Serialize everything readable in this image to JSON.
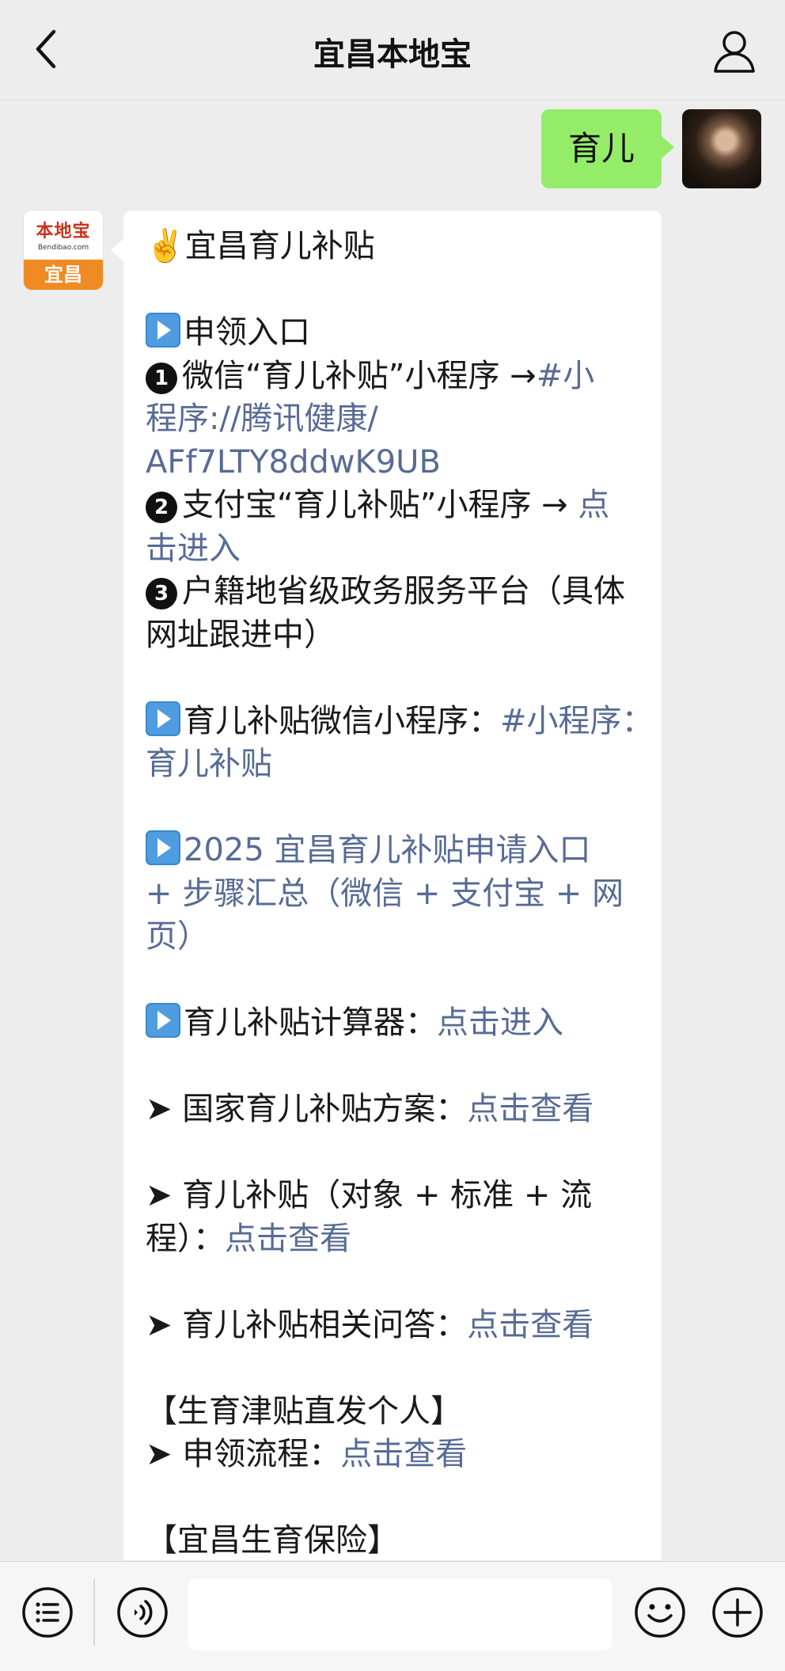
{
  "header": {
    "title": "宜昌本地宝",
    "back_icon": "chevron-left-icon",
    "profile_icon": "person-icon"
  },
  "colors": {
    "link": "#576b95",
    "user_bubble": "#95ec69",
    "background": "#ededed"
  },
  "user_message": {
    "text": "育儿"
  },
  "bot_avatar": {
    "brand": "本地宝",
    "domain": "Bendibao.com",
    "city": "宜昌"
  },
  "bot_message": {
    "title": "✌️宜昌育儿补贴",
    "section1_heading": "申领入口",
    "item1_num": "1",
    "item1_text": "微信“育儿补贴”小程序 →",
    "item1_link_a": "#小",
    "item1_link_b": "程序://腾讯健康/",
    "item1_link_c": "AFf7LTY8ddwK9UB",
    "item2_num": "2",
    "item2_text": "支付宝“育儿补贴”小程序 → ",
    "item2_link_a": "点",
    "item2_link_b": "击进入",
    "item3_num": "3",
    "item3_text_a": "户籍地省级政务服务平台（具体",
    "item3_text_b": "网址跟进中）",
    "miniapp_label": "育儿补贴微信小程序：",
    "miniapp_link_a": "#小程序：",
    "miniapp_link_b": "育儿补贴",
    "guide_link_a": "2025 宜昌育儿补贴申请入口",
    "guide_link_b": "+ 步骤汇总（微信 + 支付宝 + 网",
    "guide_link_c": "页）",
    "calc_label": "育儿补贴计算器：",
    "calc_link": "点击进入",
    "national_label": "➤ 国家育儿补贴方案：",
    "national_link": "点击查看",
    "standard_label_a": "➤ 育儿补贴（对象 + 标准 + 流",
    "standard_label_b": "程）：",
    "standard_link": "点击查看",
    "faq_label": "➤ 育儿补贴相关问答：",
    "faq_link": "点击查看",
    "allowance_heading": "【生育津贴直发个人】",
    "process_label": "➤ 申领流程：",
    "process_link": "点击查看",
    "insurance_heading": "【宜昌生育保险】"
  },
  "bottom_bar": {
    "menu_icon": "menu-list-icon",
    "voice_icon": "voice-icon",
    "input_value": "",
    "emoji_icon": "emoji-icon",
    "plus_icon": "plus-icon"
  }
}
